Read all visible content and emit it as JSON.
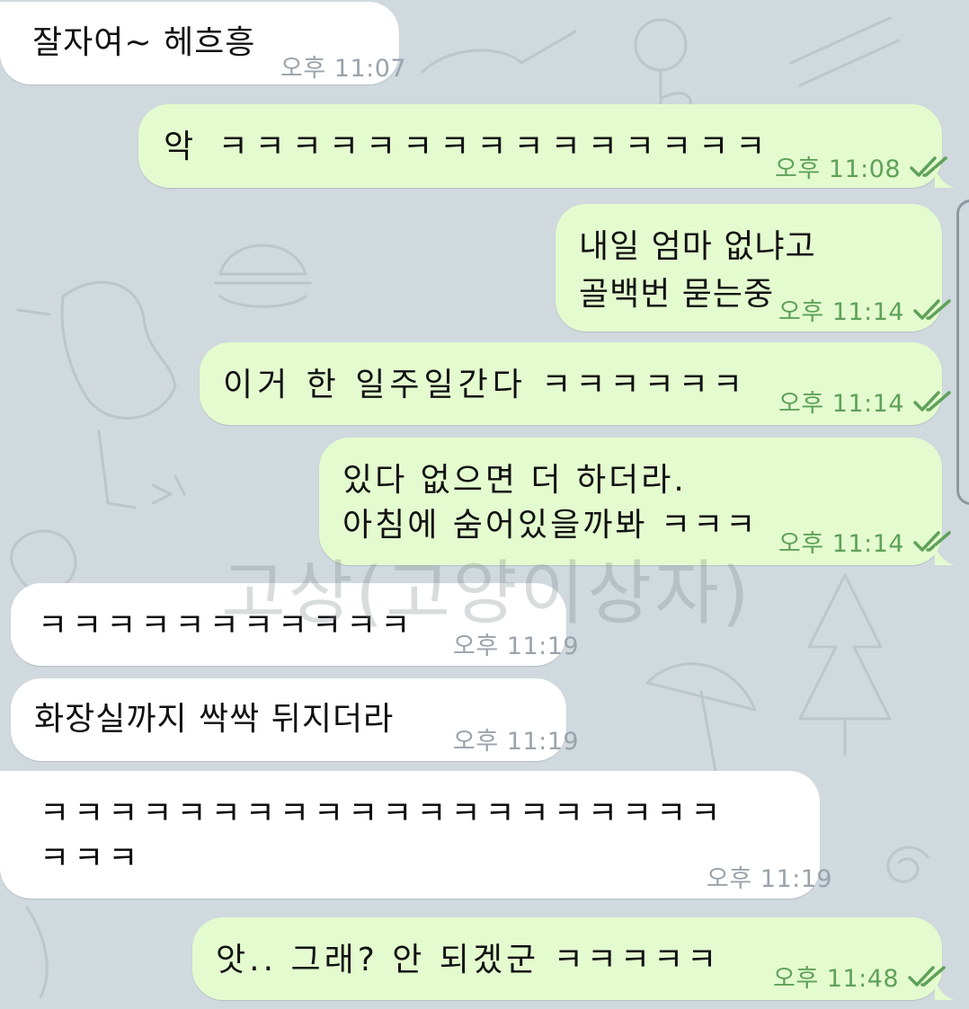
{
  "messages": [
    {
      "side": "in",
      "text": "잘자여~ 헤흐흥",
      "time": "오후 11:07"
    },
    {
      "side": "out",
      "text": "악 ㅋㅋㅋㅋㅋㅋㅋㅋㅋㅋㅋㅋㅋㅋㅋ",
      "time": "오후 11:08",
      "read": true
    },
    {
      "side": "out",
      "text_lines": [
        "내일 엄마 없냐고",
        "골백번 묻는중"
      ],
      "time": "오후 11:14",
      "read": true
    },
    {
      "side": "out",
      "text": "이거 한 일주일간다 ㅋㅋㅋㅋㅋㅋ",
      "time": "오후 11:14",
      "read": true
    },
    {
      "side": "out",
      "text_lines": [
        "있다 없으면 더 하더라.",
        "아침에 숨어있을까봐 ㅋㅋㅋ"
      ],
      "time": "오후 11:14",
      "read": true
    },
    {
      "side": "in",
      "text": "ㅋㅋㅋㅋㅋㅋㅋㅋㅋㅋㅋ",
      "time": "오후 11:19"
    },
    {
      "side": "in",
      "text": "화장실까지 싹싹 뒤지더라",
      "time": "오후 11:19"
    },
    {
      "side": "in",
      "text_lines": [
        "ㅋㅋㅋㅋㅋㅋㅋㅋㅋㅋㅋㅋㅋㅋㅋㅋㅋㅋㅋㅋ",
        "ㅋㅋㅋ"
      ],
      "time": "오후 11:19"
    },
    {
      "side": "out",
      "text": "앗.. 그래? 안 되겠군 ㅋㅋㅋㅋㅋ",
      "time": "오후 11:48",
      "read": true
    }
  ],
  "watermark": "고상(고양이상자)",
  "colors": {
    "background": "#cfd9de",
    "incoming_bubble": "#ffffff",
    "outgoing_bubble": "#e4fbcf",
    "outgoing_meta": "#5fa15a",
    "incoming_meta": "#9aa3ab"
  },
  "icons": {
    "read_receipt": "double-check-icon"
  }
}
